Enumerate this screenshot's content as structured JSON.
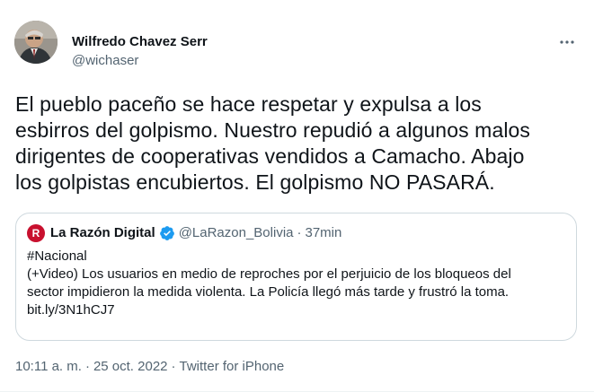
{
  "author": {
    "display_name": "Wilfredo Chavez Serr",
    "handle": "@wichaser"
  },
  "tweet": {
    "text_lines": [
      "El pueblo paceño se hace respetar y expulsa a los",
      "esbirros del golpismo. Nuestro repudió a algunos malos",
      "dirigentes de cooperativas vendidos a Camacho. Abajo",
      "los golpistas encubiertos. El golpismo NO PASARÁ."
    ]
  },
  "quote": {
    "logo_letter": "R",
    "display_name": "La Razón Digital",
    "handle": "@LaRazon_Bolivia",
    "separator": "·",
    "time": "37min",
    "lines": [
      "#Nacional",
      "(+Video) Los usuarios en medio de reproches por el perjuicio de los bloqueos del",
      "sector impidieron la medida violenta. La Policía llegó más tarde y frustró la toma.",
      "bit.ly/3N1hCJ7"
    ]
  },
  "footer": {
    "time": "10:11 a. m.",
    "separator": "·",
    "date": "25 oct. 2022",
    "source": "Twitter for iPhone"
  },
  "icons": {
    "more": "more-dots-icon",
    "verified": "verified-badge-icon"
  },
  "colors": {
    "secondary_text": "#536471",
    "verified_blue": "#1d9bf0",
    "border": "#cfd9de",
    "logo_red": "#c8102e"
  }
}
